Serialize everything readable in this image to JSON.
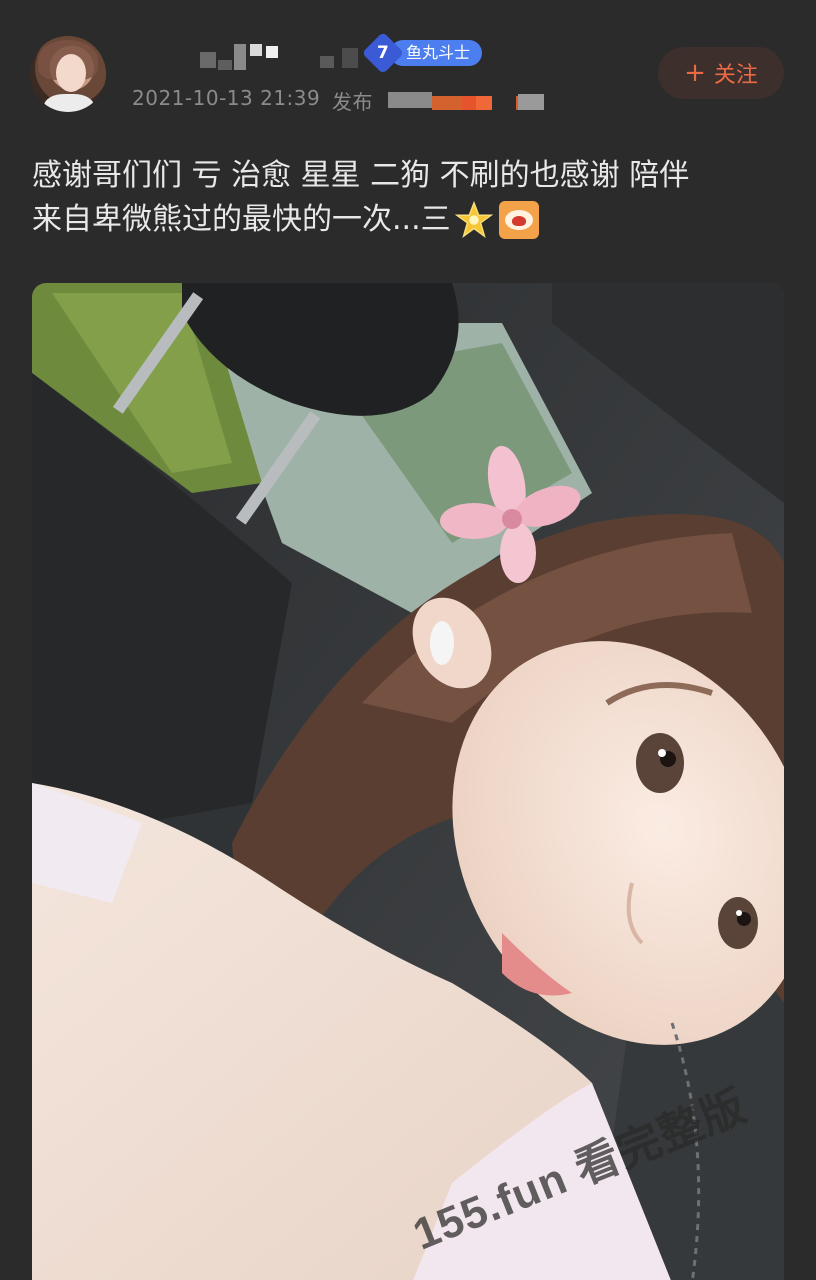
{
  "user": {
    "level": "7",
    "level_title": "鱼丸斗士",
    "post_date": "2021-10-13 21:39",
    "post_action": "发布"
  },
  "actions": {
    "follow_label": "关注",
    "follow_icon": "plus-icon"
  },
  "post": {
    "text_line_1": "感谢哥们们 亏 治愈 星星 二狗 不刷的也感谢 陪伴",
    "text_line_2": "来自卑微熊过的最快的一次...三",
    "emojis": [
      "star-emoji",
      "shocked-face-emoji"
    ]
  },
  "photo": {
    "watermark": "155.fun 看完整版"
  },
  "colors": {
    "background": "#2b2b2b",
    "accent": "#ea6a46",
    "badge_blue": "#4c7ef0",
    "meta_gray": "#8b8b8b"
  }
}
